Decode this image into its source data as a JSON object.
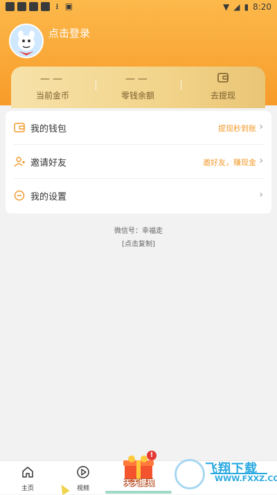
{
  "status_bar": {
    "time": "8:20"
  },
  "header": {
    "login_text": "点击登录",
    "stats": [
      {
        "value": "——",
        "label": "当前金币"
      },
      {
        "value": "——",
        "label": "零钱余额"
      },
      {
        "label": "去提现",
        "icon": "wallet-icon"
      }
    ]
  },
  "menu": [
    {
      "label": "我的钱包",
      "hint": "提现秒到账",
      "icon": "wallet-icon"
    },
    {
      "label": "邀请好友",
      "hint": "邀好友，赚现金",
      "icon": "invite-icon"
    },
    {
      "label": "我的设置",
      "hint": "",
      "icon": "settings-icon"
    }
  ],
  "footer": {
    "wechat": "微信号：幸福走",
    "copy": "[点击复制]"
  },
  "tabbar": {
    "items": [
      {
        "label": "主页",
        "icon": "home-icon"
      },
      {
        "label": "视频",
        "icon": "play-icon"
      }
    ],
    "promo": {
      "label": "天天提现",
      "badge": "!"
    }
  },
  "watermark": {
    "name": "飞翔下载",
    "url": "WWW.FXXZ.COM"
  },
  "colors": {
    "accent": "#f79b2a",
    "hint": "#f39a2c",
    "card_gold": "#f2d48a"
  }
}
